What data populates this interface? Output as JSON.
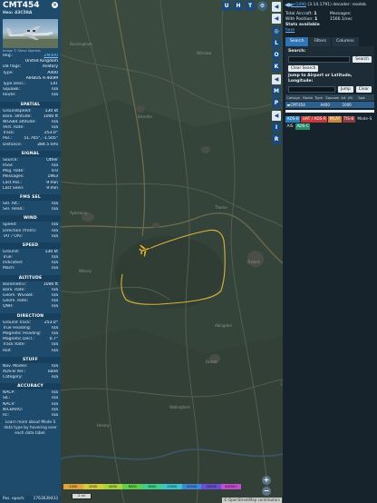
{
  "aircraft": {
    "callsign": "CMT454",
    "hex_line": "Hex: 43C58A",
    "photo_credit": "Image © Steve Sparkes"
  },
  "info_rows": [
    {
      "k": "Reg.:",
      "v": "ZM400",
      "link": true
    },
    {
      "k": "",
      "v": "United Kingdom"
    },
    {
      "k": "DB flags:",
      "v": "military"
    },
    {
      "k": "Type:",
      "v": "A400"
    },
    {
      "k": "",
      "v": "AIRBUS A-400M"
    },
    {
      "k": "Type Desc.:",
      "v": "L4T"
    },
    {
      "k": "Squawk:",
      "v": "n/a"
    },
    {
      "k": "Route:",
      "v": "n/a"
    }
  ],
  "sections": [
    {
      "title": "SPATIAL",
      "rows": [
        {
          "k": "Groundspeed:",
          "v": "130 kt"
        },
        {
          "k": "Baro. altitude:",
          "v": "1000 ft"
        },
        {
          "k": "WGS84 altitude:",
          "v": "n/a"
        },
        {
          "k": "Vert. Rate:",
          "v": "n/a"
        },
        {
          "k": "Track:",
          "v": "253.0°"
        },
        {
          "k": "Pos.:",
          "v": "51.765°, -1.505°"
        },
        {
          "k": "Distance:",
          "v": "284.5 nmi"
        }
      ]
    },
    {
      "title": "SIGNAL",
      "rows": [
        {
          "k": "Source:",
          "v": "Other"
        },
        {
          "k": "RSSI:",
          "v": "n/a"
        },
        {
          "k": "Msg. Rate:",
          "v": "0.0"
        },
        {
          "k": "Messages:",
          "v": "1963"
        },
        {
          "k": "Last Pos.:",
          "v": "9 min"
        },
        {
          "k": "Last Seen:",
          "v": "9 min"
        }
      ]
    },
    {
      "title": "FMS SEL",
      "rows": [
        {
          "k": "Sel. Alt.:",
          "v": "n/a"
        },
        {
          "k": "Sel. Head.:",
          "v": "n/a"
        }
      ]
    },
    {
      "title": "WIND",
      "rows": [
        {
          "k": "Speed:",
          "v": "n/a"
        },
        {
          "k": "Direction (from):",
          "v": "n/a"
        },
        {
          "k": "TAT / OAT:",
          "v": "n/a"
        }
      ]
    },
    {
      "title": "SPEED",
      "rows": [
        {
          "k": "Ground:",
          "v": "130 kt"
        },
        {
          "k": "True:",
          "v": "n/a"
        },
        {
          "k": "Indicated:",
          "v": "n/a"
        },
        {
          "k": "Mach:",
          "v": "n/a"
        }
      ]
    },
    {
      "title": "ALTITUDE",
      "rows": [
        {
          "k": "Barometric:",
          "v": "1000 ft"
        },
        {
          "k": "Baro. Rate:",
          "v": "n/a"
        },
        {
          "k": "Geom. WGS84:",
          "v": "n/a"
        },
        {
          "k": "Geom. Rate:",
          "v": "n/a"
        },
        {
          "k": "QNH:",
          "v": "n/a"
        }
      ]
    },
    {
      "title": "DIRECTION",
      "rows": [
        {
          "k": "Ground Track:",
          "v": "253.0°"
        },
        {
          "k": "True Heading:",
          "v": "n/a"
        },
        {
          "k": "Magnetic Heading:",
          "v": "n/a"
        },
        {
          "k": "Magnetic Decl.:",
          "v": "0.7°"
        },
        {
          "k": "Track Rate:",
          "v": "n/a"
        },
        {
          "k": "Roll:",
          "v": "n/a"
        }
      ]
    },
    {
      "title": "STUFF",
      "rows": [
        {
          "k": "Nav. Modes:",
          "v": "n/a"
        },
        {
          "k": "ADS-B Ver.:",
          "v": "none"
        },
        {
          "k": "Category:",
          "v": "n/a"
        }
      ]
    },
    {
      "title": "ACCURACY",
      "rows": [
        {
          "k": "NACP:",
          "v": "n/a"
        },
        {
          "k": "SIL:",
          "v": "n/a"
        },
        {
          "k": "NACV:",
          "v": "n/a"
        },
        {
          "k": "NICBARO:",
          "v": "n/a"
        },
        {
          "k": "Rc:",
          "v": "n/a"
        }
      ]
    }
  ],
  "learn_more": "Learn more about Mode S data type by hovering over each data label.",
  "footer": {
    "k": "Pos. epoch:",
    "v": "1763639433"
  },
  "map": {
    "top_buttons": [
      "U",
      "H",
      "T"
    ],
    "side_buttons": [
      "",
      "L",
      "O",
      "K",
      "M",
      "P",
      "I",
      "R"
    ],
    "altitude_legend": [
      "1000",
      "2000",
      "4000",
      "6000",
      "8000",
      "10000",
      "20000",
      "30000",
      "40000+"
    ],
    "scale_label": "2 mi",
    "attribution": "© OpenStreetMap contributors",
    "track_color": "#ddb13b",
    "labels": [
      "Buckingham",
      "Winslow",
      "Bicester",
      "Thame",
      "Aylesbury",
      "Oxford",
      "Abingdon",
      "Didcot",
      "Witney",
      "Wallingford",
      "Henley"
    ]
  },
  "right_panel": {
    "header_link": "wr1090",
    "header_rest": "(3.14.1791) decoder: readsb",
    "total_aircraft_label": "Total Aircraft:",
    "total_aircraft": "1",
    "with_position_label": "With Position:",
    "with_position": "1",
    "messages_label": "Messages:",
    "messages_rate": "1566.1/sec",
    "stats_line": "Stats available",
    "stats_link": "here",
    "tabs": [
      "Search",
      "Filters",
      "Columns"
    ],
    "search_label": "Search:",
    "search_button": "Search",
    "clear_search": "Clear Search",
    "jump_label": "Jump to Airport or Latitude, Longitude:",
    "jump_button": "Jump",
    "clear_button": "Clear",
    "table_headers": [
      "Callsign",
      "Route",
      "Type",
      "Squawk",
      "Alt. (ft)",
      "Spd."
    ],
    "table_rows": [
      {
        "callsign": "CMT454",
        "type": "A400",
        "alt": "1000"
      }
    ],
    "source_badges": [
      "ADS-B",
      "UAT / ADS-R",
      "MLAT",
      "TIS-B",
      "Mode-S",
      "AIS",
      "ADS-C"
    ]
  },
  "colors": {
    "panel_blue": "#1e4a6c",
    "map_dark": "#2d3a33",
    "track": "#ddb13b",
    "selected_row": "#2f5f8c"
  }
}
